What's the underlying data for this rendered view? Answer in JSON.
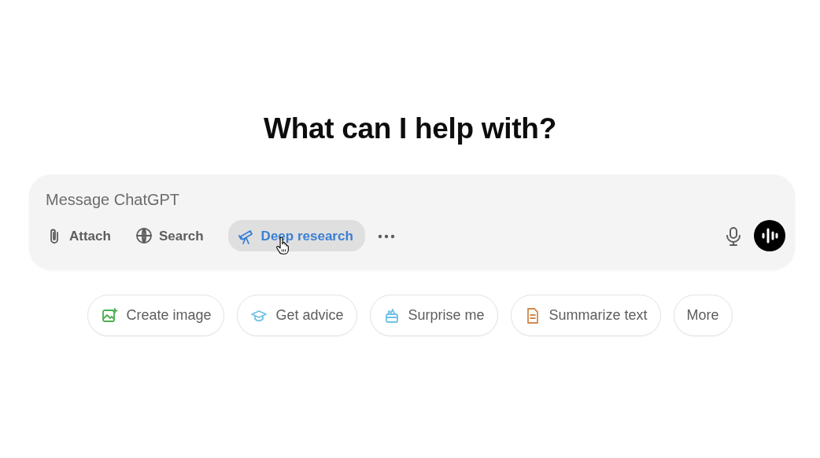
{
  "heading": "What can I help with?",
  "composer": {
    "placeholder": "Message ChatGPT",
    "tools": [
      {
        "label": "Attach",
        "kind": "attach",
        "selected": false
      },
      {
        "label": "Search",
        "kind": "search",
        "selected": false
      },
      {
        "label": "Deep research",
        "kind": "telescope",
        "selected": true
      }
    ]
  },
  "suggestions": [
    {
      "label": "Create image",
      "kind": "image",
      "color": "#4caf50"
    },
    {
      "label": "Get advice",
      "kind": "cap",
      "color": "#6ec1e4"
    },
    {
      "label": "Surprise me",
      "kind": "gift",
      "color": "#6ec1e4"
    },
    {
      "label": "Summarize text",
      "kind": "doc",
      "color": "#d08a4e"
    },
    {
      "label": "More"
    }
  ]
}
